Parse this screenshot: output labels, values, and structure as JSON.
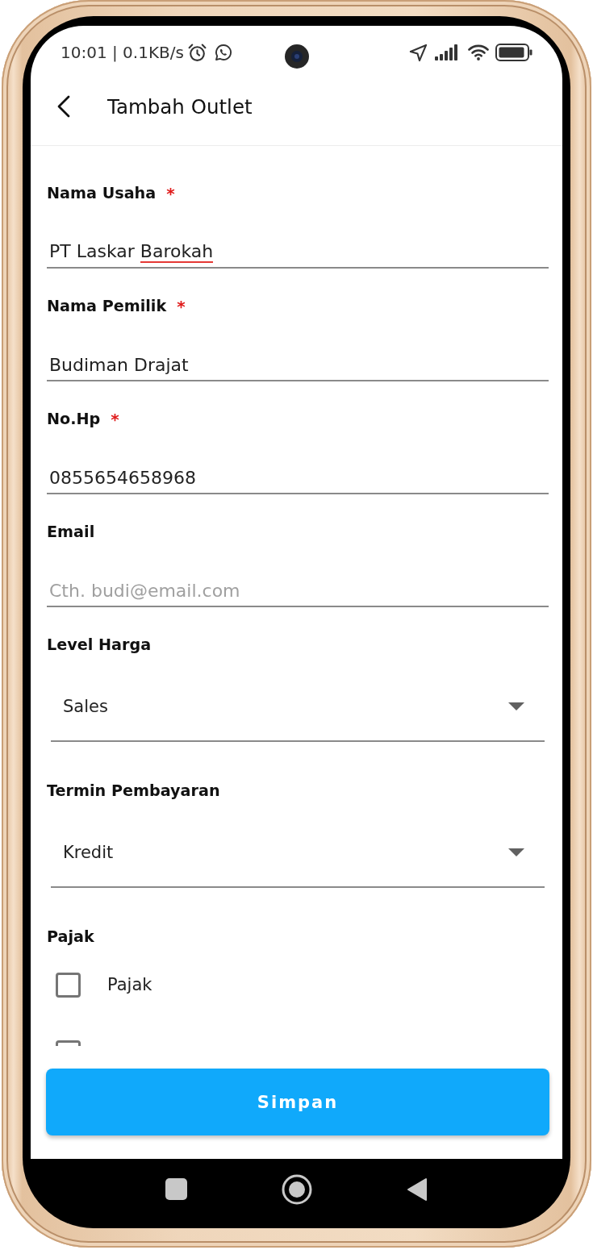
{
  "status_bar": {
    "time_and_speed": "10:01 | 0.1KB/s"
  },
  "header": {
    "title": "Tambah Outlet"
  },
  "form": {
    "fields": [
      {
        "kind": "text",
        "label": "Nama Usaha",
        "marker": "*",
        "value_parts": [
          {
            "text": "PT Laskar",
            "misspelled": false
          },
          {
            "text": "Barokah",
            "misspelled": true
          }
        ]
      },
      {
        "kind": "text",
        "label": "Nama Pemilik",
        "marker": "*",
        "value": "Budiman Drajat"
      },
      {
        "kind": "text",
        "label": "No.Hp",
        "marker": "*",
        "value": "0855654658968"
      },
      {
        "kind": "text",
        "label": "Email",
        "placeholder": "Cth. budi@email.com"
      },
      {
        "kind": "dropdown",
        "label": "Level Harga",
        "value": "Sales"
      },
      {
        "kind": "dropdown",
        "label": "Termin Pembayaran",
        "value": "Kredit"
      },
      {
        "kind": "checkboxes",
        "label": "Pajak",
        "options": [
          {
            "label": "Pajak",
            "checked": false
          },
          {
            "checked": false
          }
        ]
      }
    ]
  },
  "save_button": {
    "label": "Simpan"
  }
}
